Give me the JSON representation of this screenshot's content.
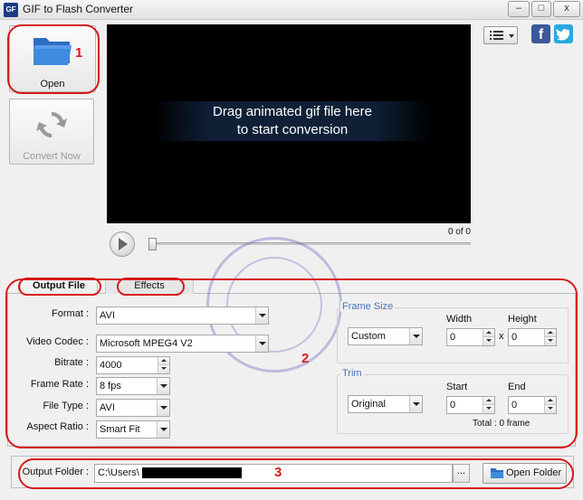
{
  "window": {
    "title": "GIF to Flash Converter",
    "icon_text": "GF"
  },
  "toolbar": {
    "open_label": "Open",
    "convert_label": "Convert Now"
  },
  "annotations": {
    "n1": "1",
    "n2": "2",
    "n3": "3"
  },
  "preview": {
    "drop_line1": "Drag animated gif file here",
    "drop_line2": "to start conversion",
    "frame_counter": "0 of 0"
  },
  "tabs": [
    {
      "label": "Output File",
      "active": true
    },
    {
      "label": "Effects",
      "active": false
    }
  ],
  "output": {
    "format_label": "Format :",
    "format_value": "AVI",
    "codec_label": "Video Codec :",
    "codec_value": "Microsoft MPEG4 V2",
    "bitrate_label": "Bitrate :",
    "bitrate_value": "4000",
    "framerate_label": "Frame Rate :",
    "framerate_value": "8 fps",
    "filetype_label": "File Type :",
    "filetype_value": "AVI",
    "aspect_label": "Aspect Ratio :",
    "aspect_value": "Smart Fit"
  },
  "frame_size": {
    "title": "Frame Size",
    "mode_value": "Custom",
    "width_label": "Width",
    "width_value": "0",
    "height_label": "Height",
    "height_value": "0",
    "times": "x"
  },
  "trim": {
    "title": "Trim",
    "mode_value": "Original",
    "start_label": "Start",
    "start_value": "0",
    "end_label": "End",
    "end_value": "0",
    "total_text": "Total : 0 frame"
  },
  "output_folder": {
    "label": "Output Folder :",
    "path_value": "C:\\Users\\",
    "browse_label": "...",
    "open_folder_label": "Open Folder"
  },
  "window_controls": {
    "minimize": "–",
    "maximize": "□",
    "close": "x"
  },
  "social": {
    "facebook": "f"
  },
  "colors": {
    "accent_blue": "#4a74b8",
    "annotation_red": "#d81a1a",
    "facebook": "#3b5998",
    "twitter": "#2aa9e0"
  }
}
